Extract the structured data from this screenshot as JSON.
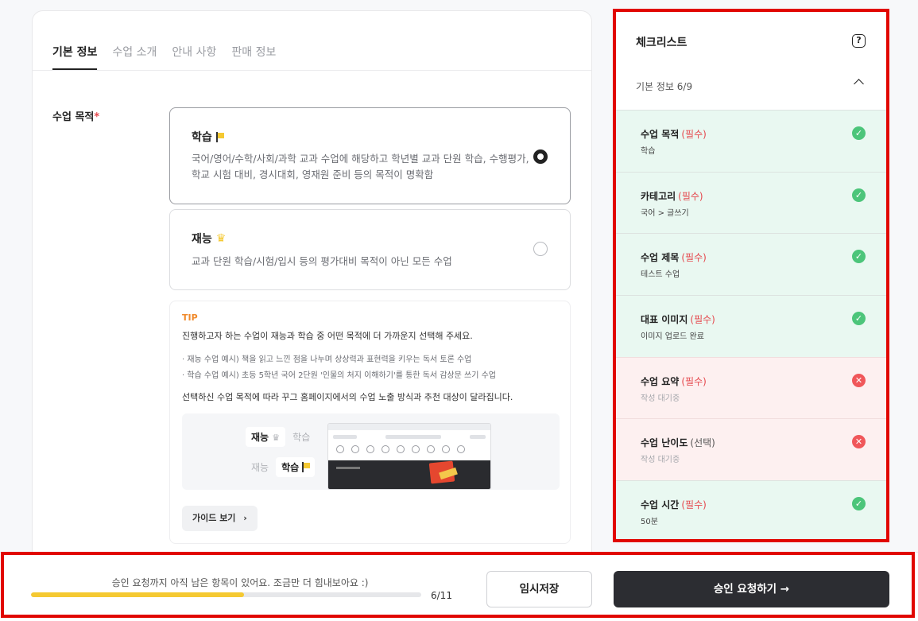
{
  "tabs": [
    {
      "label": "기본 정보",
      "active": true
    },
    {
      "label": "수업 소개"
    },
    {
      "label": "안내 사항"
    },
    {
      "label": "판매 정보"
    }
  ],
  "purpose": {
    "label": "수업 목적",
    "required_mark": "*",
    "options": [
      {
        "title": "학습",
        "icon": "flag-icon",
        "selected": true,
        "desc": "국어/영어/수학/사회/과학 교과 수업에 해당하고 학년별 교과 단원 학습, 수행평가, 학교 시험 대비, 경시대회, 영재원 준비 등의 목적이 명확함"
      },
      {
        "title": "재능",
        "icon": "crown-icon",
        "selected": false,
        "desc": "교과 단원 학습/시험/입시 등의 평가대비 목적이 아닌 모든 수업"
      }
    ]
  },
  "tip": {
    "label": "TIP",
    "lead": "진행하고자 하는 수업이 재능과 학습 중 어떤 목적에 더 가까운지 선택해 주세요.",
    "examples": [
      "· 재능 수업 예시) 책을 읽고 느낀 점을 나누며 상상력과 표현력을 키우는 독서 토론 수업",
      "· 학습 수업 예시) 초등 5학년 국어 2단원 '인물의 처지 이해하기'를 통한 독서 감상문 쓰기 수업"
    ],
    "note": "선택하신 수업 목적에 따라 꾸그 홈페이지에서의 수업 노출 방식과 추천 대상이 달라집니다.",
    "toggle_a": {
      "on": "재능",
      "off": "학습"
    },
    "toggle_b": {
      "off": "재능",
      "on": "학습"
    },
    "guide_button": "가이드 보기",
    "guide_arrow": "›"
  },
  "checklist": {
    "title": "체크리스트",
    "help_icon": "?",
    "section_label": "기본 정보 6/9",
    "items": [
      {
        "name": "수업 목적",
        "tag": "(필수)",
        "value": "학습",
        "status": "ok"
      },
      {
        "name": "카테고리",
        "tag": "(필수)",
        "value": "국어 > 글쓰기",
        "status": "ok"
      },
      {
        "name": "수업 제목",
        "tag": "(필수)",
        "value": "테스트 수업",
        "status": "ok"
      },
      {
        "name": "대표 이미지",
        "tag": "(필수)",
        "value": "이미지 업로드 완료",
        "status": "ok"
      },
      {
        "name": "수업 요약",
        "tag": "(필수)",
        "value": "작성 대기중",
        "status": "bad"
      },
      {
        "name": "수업 난이도",
        "tag": "(선택)",
        "value": "작성 대기중",
        "status": "bad"
      },
      {
        "name": "수업 시간",
        "tag": "(필수)",
        "value": "50분",
        "status": "ok"
      }
    ],
    "status_glyphs": {
      "ok": "✓",
      "bad": "✕"
    },
    "colors": {
      "ok": "#4cc57a",
      "bad": "#f0575a"
    }
  },
  "footer": {
    "message": "승인 요청까지 아직 남은 항목이 있어요. 조금만 더 힘내보아요 :)",
    "progress_fraction": 0.545,
    "progress_text": "6/11",
    "draft_button": "임시저장",
    "submit_button": "승인 요청하기 →"
  },
  "colors": {
    "accent_yellow": "#f5c932",
    "highlight_red": "#e10600",
    "primary_dark": "#2c2d32"
  }
}
